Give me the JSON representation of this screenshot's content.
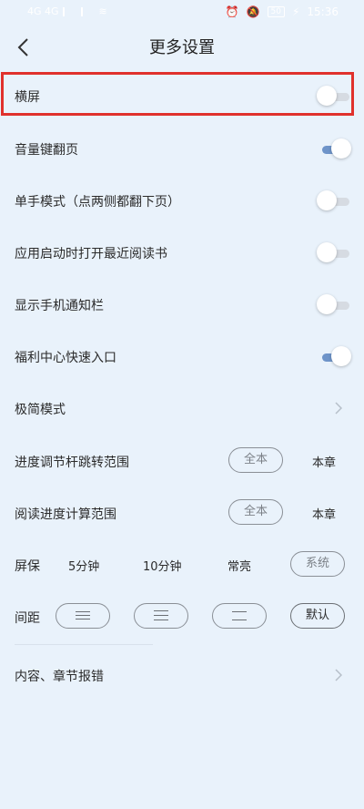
{
  "status_bar": {
    "left_text": "4G 4G",
    "time": "15:36",
    "battery": "50"
  },
  "header": {
    "title": "更多设置"
  },
  "settings": {
    "landscape": {
      "label": "横屏",
      "on": false
    },
    "volume_page": {
      "label": "音量键翻页",
      "on": true
    },
    "one_hand": {
      "label": "单手模式（点两侧都翻下页）",
      "on": false
    },
    "open_recent": {
      "label": "应用启动时打开最近阅读书",
      "on": false
    },
    "show_notify": {
      "label": "显示手机通知栏",
      "on": false
    },
    "welfare_entry": {
      "label": "福利中心快速入口",
      "on": true
    },
    "minimal_mode": {
      "label": "极简模式"
    },
    "progress_jump": {
      "label": "进度调节杆跳转范围",
      "options": [
        "全本",
        "本章"
      ]
    },
    "progress_calc": {
      "label": "阅读进度计算范围",
      "options": [
        "全本",
        "本章"
      ]
    },
    "screen_saver": {
      "label": "屏保",
      "options": [
        "5分钟",
        "10分钟",
        "常亮",
        "系统"
      ]
    },
    "spacing": {
      "label": "间距",
      "default_label": "默认"
    },
    "report": {
      "label": "内容、章节报错"
    }
  }
}
